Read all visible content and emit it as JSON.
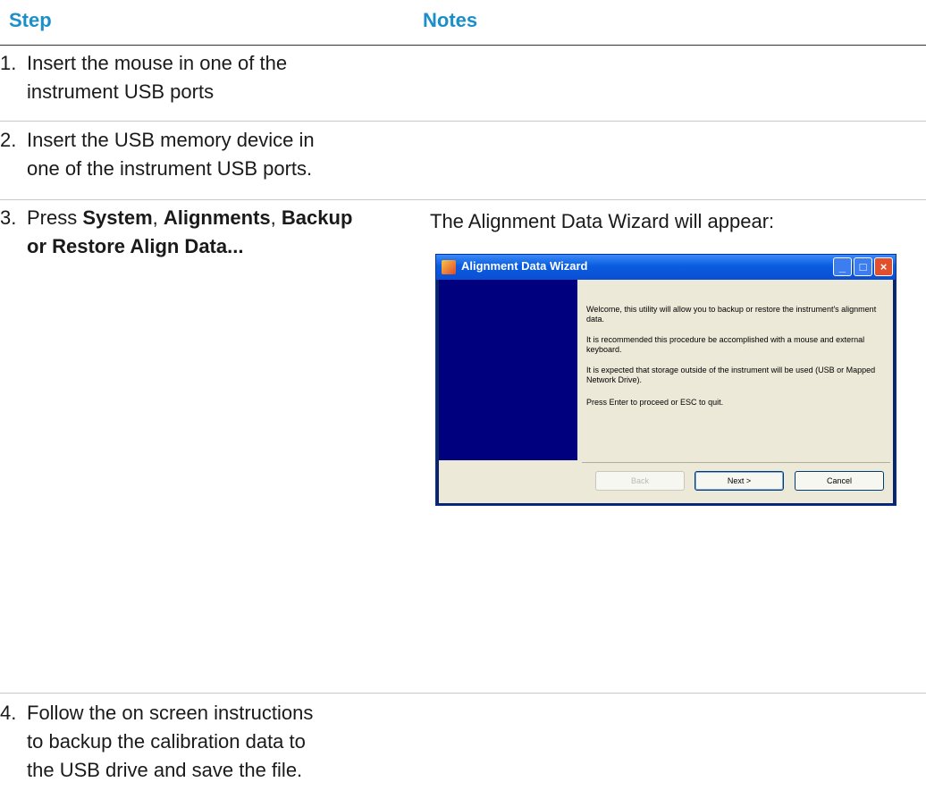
{
  "header": {
    "step": "Step",
    "notes": "Notes"
  },
  "steps": [
    {
      "num": "1.",
      "lines": [
        "Insert the mouse in one of the",
        "instrument USB ports"
      ]
    },
    {
      "num": "2.",
      "lines": [
        "Insert the USB memory device in",
        "one of the instrument USB ports."
      ]
    },
    {
      "num": "3.",
      "prefix": "Press ",
      "b1": "System",
      "sep1": ", ",
      "b2": "Alignments",
      "sep2": ", ",
      "b3": "Backup",
      "b4": "or Restore Align Data..."
    },
    {
      "num": "4.",
      "lines": [
        "Follow the on screen instructions",
        "to backup the calibration data to",
        "the USB drive and save the file."
      ]
    }
  ],
  "note3": "The Alignment Data Wizard will appear:",
  "wizard": {
    "title": "Alignment Data Wizard",
    "messages": [
      "Welcome, this utility will allow you to backup or restore the instrument's alignment data.",
      "It is recommended this procedure be accomplished with a mouse and external keyboard.",
      "It is expected that storage outside of the instrument will be used (USB or Mapped Network Drive).",
      "Press Enter to proceed or ESC to quit."
    ],
    "buttons": {
      "back": "Back",
      "next": "Next >",
      "cancel": "Cancel"
    }
  }
}
